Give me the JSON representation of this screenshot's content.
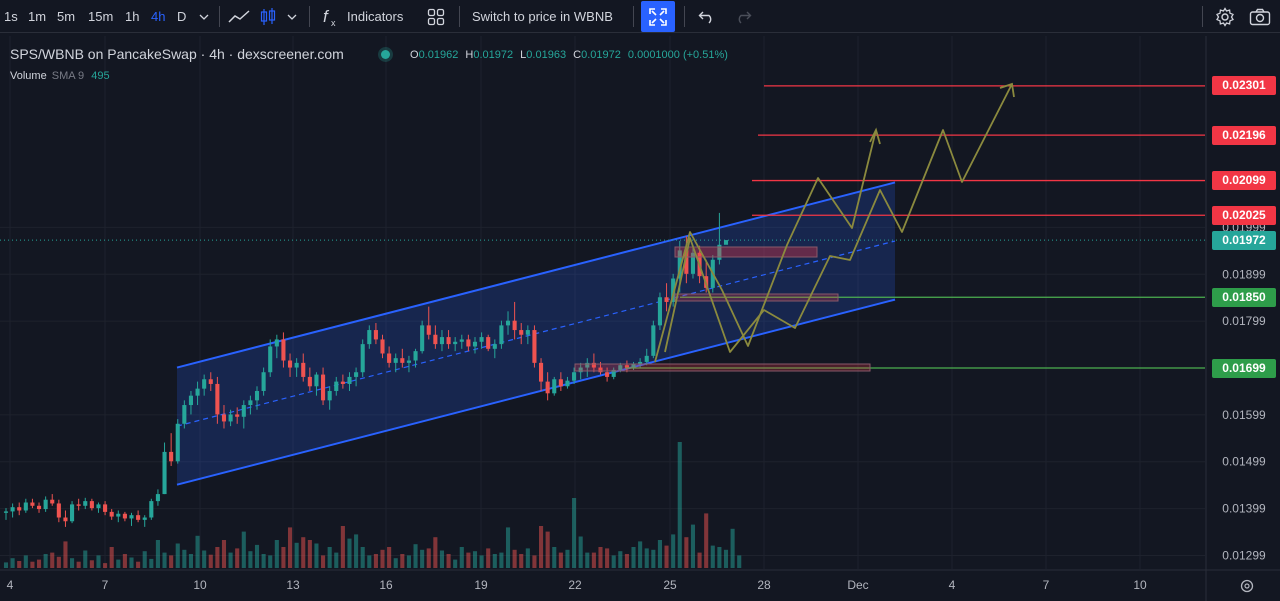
{
  "toolbar": {
    "intervals": [
      "1s",
      "1m",
      "5m",
      "15m",
      "1h",
      "4h",
      "D"
    ],
    "active_interval": "4h",
    "indicators_label": "Indicators",
    "switch_label": "Switch to price in WBNB",
    "icons": [
      "chevron-down-icon",
      "line-chart-icon",
      "candles-icon",
      "function-icon",
      "templates-icon",
      "fullscreen-icon",
      "undo-icon",
      "redo-icon",
      "settings-icon",
      "camera-icon"
    ]
  },
  "legend": {
    "title": "SPS/WBNB on PancakeSwap · 4h · dexscreener.com",
    "ohlc": {
      "o_key": "O",
      "o": "0.01962",
      "h_key": "H",
      "h": "0.01972",
      "l_key": "L",
      "l": "0.01963",
      "c_key": "C",
      "c": "0.01972",
      "change": "0.0001000 (+0.51%)"
    },
    "volume_label": "Volume",
    "volume_sma": "SMA 9",
    "volume_value": "495"
  },
  "colors": {
    "background": "#131722",
    "up": "#26a69a",
    "down": "#ef5350",
    "channel": "#2962ff",
    "resistance": "#f23645",
    "support": "#4caf50",
    "projection": "#8b8a3e"
  },
  "chart_data": {
    "type": "candlestick",
    "pair": "SPS/WBNB",
    "interval": "4h",
    "x_tick_labels": [
      "4",
      "7",
      "10",
      "13",
      "16",
      "19",
      "22",
      "25",
      "28",
      "Dec",
      "4",
      "7",
      "10"
    ],
    "y_tick_labels": [
      "0.01999",
      "0.01899",
      "0.01799",
      "0.01599",
      "0.01499",
      "0.01399",
      "0.01299"
    ],
    "ylim": [
      0.0125,
      0.0235
    ],
    "last_price": "0.01972",
    "horizontal_levels": [
      {
        "value": "0.02301",
        "kind": "resistance"
      },
      {
        "value": "0.02196",
        "kind": "resistance"
      },
      {
        "value": "0.02099",
        "kind": "resistance"
      },
      {
        "value": "0.02025",
        "kind": "resistance"
      },
      {
        "value": "0.01850",
        "kind": "support"
      },
      {
        "value": "0.01699",
        "kind": "support"
      }
    ],
    "channel": {
      "lower_start": 0.0145,
      "lower_end": 0.01845,
      "upper_start": 0.017,
      "upper_end": 0.02095
    },
    "candles": [
      {
        "o": 0.0139,
        "h": 0.014,
        "l": 0.01375,
        "c": 0.01393
      },
      {
        "o": 0.01393,
        "h": 0.0141,
        "l": 0.0138,
        "c": 0.01402
      },
      {
        "o": 0.01402,
        "h": 0.01412,
        "l": 0.01385,
        "c": 0.01395
      },
      {
        "o": 0.01395,
        "h": 0.0142,
        "l": 0.0139,
        "c": 0.01412
      },
      {
        "o": 0.01412,
        "h": 0.0142,
        "l": 0.014,
        "c": 0.01405
      },
      {
        "o": 0.01405,
        "h": 0.01412,
        "l": 0.0139,
        "c": 0.01398
      },
      {
        "o": 0.01398,
        "h": 0.01425,
        "l": 0.01392,
        "c": 0.01418
      },
      {
        "o": 0.01418,
        "h": 0.0143,
        "l": 0.01405,
        "c": 0.0141
      },
      {
        "o": 0.0141,
        "h": 0.01418,
        "l": 0.0137,
        "c": 0.0138
      },
      {
        "o": 0.0138,
        "h": 0.01395,
        "l": 0.0136,
        "c": 0.01372
      },
      {
        "o": 0.01372,
        "h": 0.01415,
        "l": 0.01368,
        "c": 0.01408
      },
      {
        "o": 0.01408,
        "h": 0.0142,
        "l": 0.01395,
        "c": 0.01405
      },
      {
        "o": 0.01405,
        "h": 0.01422,
        "l": 0.01398,
        "c": 0.01415
      },
      {
        "o": 0.01415,
        "h": 0.0142,
        "l": 0.01395,
        "c": 0.014
      },
      {
        "o": 0.014,
        "h": 0.01412,
        "l": 0.0139,
        "c": 0.01408
      },
      {
        "o": 0.01408,
        "h": 0.01415,
        "l": 0.01385,
        "c": 0.01392
      },
      {
        "o": 0.01392,
        "h": 0.01398,
        "l": 0.01375,
        "c": 0.01382
      },
      {
        "o": 0.01382,
        "h": 0.01395,
        "l": 0.0137,
        "c": 0.01388
      },
      {
        "o": 0.01388,
        "h": 0.01392,
        "l": 0.01372,
        "c": 0.01378
      },
      {
        "o": 0.01378,
        "h": 0.0139,
        "l": 0.01362,
        "c": 0.01385
      },
      {
        "o": 0.01385,
        "h": 0.01395,
        "l": 0.0137,
        "c": 0.01375
      },
      {
        "o": 0.01375,
        "h": 0.01385,
        "l": 0.0136,
        "c": 0.0138
      },
      {
        "o": 0.0138,
        "h": 0.0142,
        "l": 0.01375,
        "c": 0.01415
      },
      {
        "o": 0.01415,
        "h": 0.0144,
        "l": 0.01405,
        "c": 0.0143
      },
      {
        "o": 0.0143,
        "h": 0.0154,
        "l": 0.0143,
        "c": 0.0152
      },
      {
        "o": 0.0152,
        "h": 0.0156,
        "l": 0.0149,
        "c": 0.015
      },
      {
        "o": 0.015,
        "h": 0.0159,
        "l": 0.01495,
        "c": 0.0158
      },
      {
        "o": 0.0158,
        "h": 0.0163,
        "l": 0.0157,
        "c": 0.0162
      },
      {
        "o": 0.0162,
        "h": 0.0165,
        "l": 0.016,
        "c": 0.0164
      },
      {
        "o": 0.0164,
        "h": 0.0167,
        "l": 0.0162,
        "c": 0.01655
      },
      {
        "o": 0.01655,
        "h": 0.01685,
        "l": 0.0164,
        "c": 0.01675
      },
      {
        "o": 0.01675,
        "h": 0.0169,
        "l": 0.0165,
        "c": 0.01665
      },
      {
        "o": 0.01665,
        "h": 0.0168,
        "l": 0.0158,
        "c": 0.016
      },
      {
        "o": 0.016,
        "h": 0.0162,
        "l": 0.0157,
        "c": 0.01585
      },
      {
        "o": 0.01585,
        "h": 0.0161,
        "l": 0.01575,
        "c": 0.016
      },
      {
        "o": 0.016,
        "h": 0.01615,
        "l": 0.0158,
        "c": 0.01595
      },
      {
        "o": 0.01595,
        "h": 0.0163,
        "l": 0.0157,
        "c": 0.0162
      },
      {
        "o": 0.0162,
        "h": 0.0164,
        "l": 0.016,
        "c": 0.0163
      },
      {
        "o": 0.0163,
        "h": 0.0166,
        "l": 0.0161,
        "c": 0.0165
      },
      {
        "o": 0.0165,
        "h": 0.017,
        "l": 0.0164,
        "c": 0.0169
      },
      {
        "o": 0.0169,
        "h": 0.0176,
        "l": 0.0168,
        "c": 0.01745
      },
      {
        "o": 0.01745,
        "h": 0.0177,
        "l": 0.0172,
        "c": 0.0176
      },
      {
        "o": 0.0176,
        "h": 0.01775,
        "l": 0.017,
        "c": 0.01715
      },
      {
        "o": 0.01715,
        "h": 0.0173,
        "l": 0.0168,
        "c": 0.017
      },
      {
        "o": 0.017,
        "h": 0.0172,
        "l": 0.0168,
        "c": 0.0171
      },
      {
        "o": 0.0171,
        "h": 0.0173,
        "l": 0.0167,
        "c": 0.0168
      },
      {
        "o": 0.0168,
        "h": 0.017,
        "l": 0.0165,
        "c": 0.0166
      },
      {
        "o": 0.0166,
        "h": 0.0169,
        "l": 0.0164,
        "c": 0.01685
      },
      {
        "o": 0.01685,
        "h": 0.017,
        "l": 0.0162,
        "c": 0.0163
      },
      {
        "o": 0.0163,
        "h": 0.0166,
        "l": 0.0161,
        "c": 0.0165
      },
      {
        "o": 0.0165,
        "h": 0.0168,
        "l": 0.0164,
        "c": 0.0167
      },
      {
        "o": 0.0167,
        "h": 0.01685,
        "l": 0.01655,
        "c": 0.01665
      },
      {
        "o": 0.01665,
        "h": 0.0169,
        "l": 0.0165,
        "c": 0.0168
      },
      {
        "o": 0.0168,
        "h": 0.017,
        "l": 0.0166,
        "c": 0.0169
      },
      {
        "o": 0.0169,
        "h": 0.0176,
        "l": 0.0168,
        "c": 0.0175
      },
      {
        "o": 0.0175,
        "h": 0.0179,
        "l": 0.0174,
        "c": 0.0178
      },
      {
        "o": 0.0178,
        "h": 0.01795,
        "l": 0.0175,
        "c": 0.0176
      },
      {
        "o": 0.0176,
        "h": 0.0177,
        "l": 0.0172,
        "c": 0.0173
      },
      {
        "o": 0.0173,
        "h": 0.01745,
        "l": 0.017,
        "c": 0.0171
      },
      {
        "o": 0.0171,
        "h": 0.0173,
        "l": 0.0169,
        "c": 0.0172
      },
      {
        "o": 0.0172,
        "h": 0.0174,
        "l": 0.017,
        "c": 0.0171
      },
      {
        "o": 0.0171,
        "h": 0.01725,
        "l": 0.0169,
        "c": 0.01715
      },
      {
        "o": 0.01715,
        "h": 0.0174,
        "l": 0.017,
        "c": 0.01735
      },
      {
        "o": 0.01735,
        "h": 0.018,
        "l": 0.0173,
        "c": 0.0179
      },
      {
        "o": 0.0179,
        "h": 0.0183,
        "l": 0.0176,
        "c": 0.0177
      },
      {
        "o": 0.0177,
        "h": 0.0179,
        "l": 0.0174,
        "c": 0.0175
      },
      {
        "o": 0.0175,
        "h": 0.0178,
        "l": 0.01735,
        "c": 0.01765
      },
      {
        "o": 0.01765,
        "h": 0.0178,
        "l": 0.0174,
        "c": 0.0175
      },
      {
        "o": 0.0175,
        "h": 0.01765,
        "l": 0.01735,
        "c": 0.01755
      },
      {
        "o": 0.01755,
        "h": 0.0177,
        "l": 0.0174,
        "c": 0.0176
      },
      {
        "o": 0.0176,
        "h": 0.0177,
        "l": 0.01735,
        "c": 0.01745
      },
      {
        "o": 0.01745,
        "h": 0.01765,
        "l": 0.0173,
        "c": 0.01755
      },
      {
        "o": 0.01755,
        "h": 0.01775,
        "l": 0.0174,
        "c": 0.01765
      },
      {
        "o": 0.01765,
        "h": 0.0177,
        "l": 0.01735,
        "c": 0.0174
      },
      {
        "o": 0.0174,
        "h": 0.0176,
        "l": 0.0172,
        "c": 0.0175
      },
      {
        "o": 0.0175,
        "h": 0.018,
        "l": 0.0174,
        "c": 0.0179
      },
      {
        "o": 0.0179,
        "h": 0.0182,
        "l": 0.0177,
        "c": 0.018
      },
      {
        "o": 0.018,
        "h": 0.0184,
        "l": 0.0176,
        "c": 0.0178
      },
      {
        "o": 0.0178,
        "h": 0.01795,
        "l": 0.0175,
        "c": 0.0177
      },
      {
        "o": 0.0177,
        "h": 0.0179,
        "l": 0.0175,
        "c": 0.0178
      },
      {
        "o": 0.0178,
        "h": 0.0179,
        "l": 0.017,
        "c": 0.0171
      },
      {
        "o": 0.0171,
        "h": 0.0172,
        "l": 0.0165,
        "c": 0.0167
      },
      {
        "o": 0.0167,
        "h": 0.0169,
        "l": 0.0163,
        "c": 0.01645
      },
      {
        "o": 0.01645,
        "h": 0.0168,
        "l": 0.0164,
        "c": 0.01675
      },
      {
        "o": 0.01675,
        "h": 0.0169,
        "l": 0.0165,
        "c": 0.0166
      },
      {
        "o": 0.0166,
        "h": 0.0168,
        "l": 0.01655,
        "c": 0.01672
      },
      {
        "o": 0.01672,
        "h": 0.017,
        "l": 0.01665,
        "c": 0.0169
      },
      {
        "o": 0.0169,
        "h": 0.0171,
        "l": 0.01675,
        "c": 0.017
      },
      {
        "o": 0.017,
        "h": 0.0172,
        "l": 0.0168,
        "c": 0.0171
      },
      {
        "o": 0.0171,
        "h": 0.0173,
        "l": 0.0169,
        "c": 0.017
      },
      {
        "o": 0.017,
        "h": 0.01712,
        "l": 0.01685,
        "c": 0.0169
      },
      {
        "o": 0.0169,
        "h": 0.017,
        "l": 0.0167,
        "c": 0.0168
      },
      {
        "o": 0.0168,
        "h": 0.017,
        "l": 0.01675,
        "c": 0.01695
      },
      {
        "o": 0.01695,
        "h": 0.0171,
        "l": 0.0169,
        "c": 0.01705
      },
      {
        "o": 0.01705,
        "h": 0.01715,
        "l": 0.0169,
        "c": 0.017
      },
      {
        "o": 0.017,
        "h": 0.01712,
        "l": 0.01695,
        "c": 0.01708
      },
      {
        "o": 0.01708,
        "h": 0.0172,
        "l": 0.017,
        "c": 0.01712
      },
      {
        "o": 0.01712,
        "h": 0.0174,
        "l": 0.01705,
        "c": 0.01725
      },
      {
        "o": 0.01725,
        "h": 0.018,
        "l": 0.0172,
        "c": 0.0179
      },
      {
        "o": 0.0179,
        "h": 0.0186,
        "l": 0.0178,
        "c": 0.0185
      },
      {
        "o": 0.0185,
        "h": 0.0188,
        "l": 0.0182,
        "c": 0.0184
      },
      {
        "o": 0.0184,
        "h": 0.019,
        "l": 0.0183,
        "c": 0.0189
      },
      {
        "o": 0.0189,
        "h": 0.0197,
        "l": 0.0186,
        "c": 0.0195
      },
      {
        "o": 0.0195,
        "h": 0.0198,
        "l": 0.0188,
        "c": 0.019
      },
      {
        "o": 0.019,
        "h": 0.0196,
        "l": 0.0189,
        "c": 0.01945
      },
      {
        "o": 0.01945,
        "h": 0.0196,
        "l": 0.0188,
        "c": 0.01895
      },
      {
        "o": 0.01895,
        "h": 0.0193,
        "l": 0.0186,
        "c": 0.0187
      },
      {
        "o": 0.0187,
        "h": 0.0194,
        "l": 0.0186,
        "c": 0.0193
      },
      {
        "o": 0.0193,
        "h": 0.0203,
        "l": 0.0192,
        "c": 0.01962
      },
      {
        "o": 0.01962,
        "h": 0.01972,
        "l": 0.01963,
        "c": 0.01972
      }
    ],
    "volumes": [
      8,
      14,
      10,
      18,
      9,
      12,
      20,
      22,
      16,
      38,
      14,
      9,
      25,
      11,
      18,
      7,
      30,
      12,
      20,
      15,
      9,
      24,
      13,
      40,
      22,
      18,
      35,
      26,
      20,
      46,
      25,
      19,
      30,
      40,
      22,
      28,
      52,
      24,
      33,
      20,
      18,
      40,
      30,
      58,
      36,
      44,
      40,
      35,
      18,
      30,
      22,
      60,
      42,
      48,
      30,
      18,
      20,
      26,
      30,
      14,
      20,
      18,
      34,
      26,
      28,
      44,
      25,
      20,
      12,
      30,
      22,
      24,
      18,
      28,
      20,
      22,
      58,
      26,
      20,
      28,
      18,
      60,
      52,
      30,
      22,
      26,
      100,
      45,
      22,
      22,
      30,
      28,
      18,
      24,
      20,
      30,
      38,
      28,
      26,
      40,
      32,
      48,
      180,
      44,
      62,
      22,
      78,
      32,
      30,
      26,
      56,
      18
    ],
    "volume_ylim": [
      0,
      200
    ]
  }
}
